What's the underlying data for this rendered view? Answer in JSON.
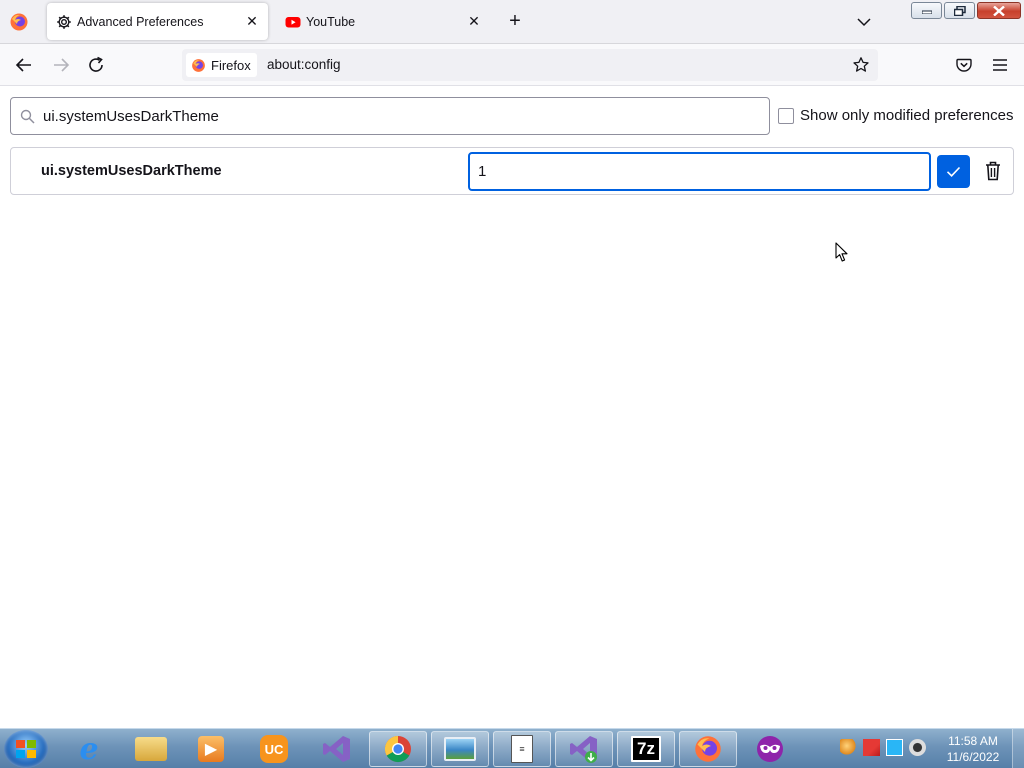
{
  "browser": {
    "tabs": [
      {
        "title": "Advanced Preferences",
        "icon": "gear-icon",
        "active": true
      },
      {
        "title": "YouTube",
        "icon": "youtube-icon",
        "active": false
      }
    ],
    "identity_label": "Firefox",
    "url": "about:config"
  },
  "config": {
    "search_value": "ui.systemUsesDarkTheme",
    "show_modified_label": "Show only modified preferences",
    "show_modified_checked": false,
    "preference": {
      "name": "ui.systemUsesDarkTheme",
      "value": "1"
    }
  },
  "taskbar": {
    "items": [
      "internet-explorer-icon",
      "file-explorer-icon",
      "media-player-icon",
      "uc-browser-icon",
      "visual-studio-icon",
      "chrome-icon",
      "photo-viewer-icon",
      "notepad-icon",
      "visual-studio-installer-icon",
      "7zip-icon",
      "firefox-icon",
      "masked-app-icon"
    ],
    "time": "11:58 AM",
    "date": "11/6/2022"
  },
  "colors": {
    "accent": "#0061e0",
    "tabstrip_bg": "#f0f0f4",
    "youtube_red": "#ff0000"
  }
}
